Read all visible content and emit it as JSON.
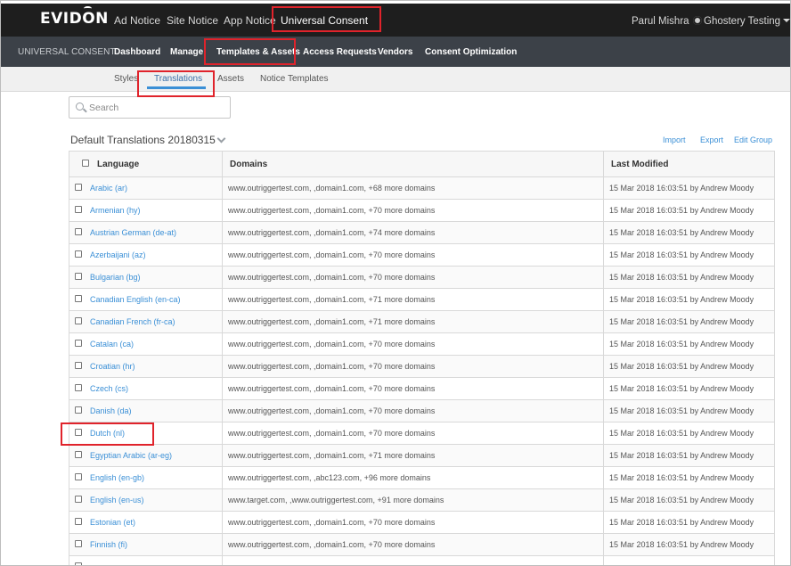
{
  "top_nav": {
    "logo": "EVIDON",
    "links": [
      "Ad Notice",
      "Site Notice",
      "App Notice",
      "Universal Consent"
    ],
    "user": "Parul Mishra",
    "account": "Ghostery Testing"
  },
  "sub_nav": {
    "title": "UNIVERSAL CONSENT",
    "items": [
      "Dashboard",
      "Manage",
      "Templates & Assets",
      "Access Requests",
      "Vendors",
      "Consent Optimization"
    ]
  },
  "third_nav": {
    "items": [
      "Styles",
      "Translations",
      "Assets",
      "Notice Templates"
    ],
    "active": "Translations"
  },
  "search": {
    "placeholder": "Search"
  },
  "group": {
    "title": "Default Translations 20180315",
    "actions": [
      "Import",
      "Export",
      "Edit Group"
    ]
  },
  "table": {
    "columns": [
      "Language",
      "Domains",
      "Last Modified"
    ],
    "rows": [
      {
        "language": "Arabic (ar)",
        "domains": "www.outriggertest.com, ,domain1.com, +68 more domains",
        "modified": "15 Mar 2018 16:03:51 by Andrew Moody"
      },
      {
        "language": "Armenian (hy)",
        "domains": "www.outriggertest.com, ,domain1.com, +70 more domains",
        "modified": "15 Mar 2018 16:03:51 by Andrew Moody"
      },
      {
        "language": "Austrian German (de-at)",
        "domains": "www.outriggertest.com, ,domain1.com, +74 more domains",
        "modified": "15 Mar 2018 16:03:51 by Andrew Moody"
      },
      {
        "language": "Azerbaijani (az)",
        "domains": "www.outriggertest.com, ,domain1.com, +70 more domains",
        "modified": "15 Mar 2018 16:03:51 by Andrew Moody"
      },
      {
        "language": "Bulgarian (bg)",
        "domains": "www.outriggertest.com, ,domain1.com, +70 more domains",
        "modified": "15 Mar 2018 16:03:51 by Andrew Moody"
      },
      {
        "language": "Canadian English (en-ca)",
        "domains": "www.outriggertest.com, ,domain1.com, +71 more domains",
        "modified": "15 Mar 2018 16:03:51 by Andrew Moody"
      },
      {
        "language": "Canadian French (fr-ca)",
        "domains": "www.outriggertest.com, ,domain1.com, +71 more domains",
        "modified": "15 Mar 2018 16:03:51 by Andrew Moody"
      },
      {
        "language": "Catalan (ca)",
        "domains": "www.outriggertest.com, ,domain1.com, +70 more domains",
        "modified": "15 Mar 2018 16:03:51 by Andrew Moody"
      },
      {
        "language": "Croatian (hr)",
        "domains": "www.outriggertest.com, ,domain1.com, +70 more domains",
        "modified": "15 Mar 2018 16:03:51 by Andrew Moody"
      },
      {
        "language": "Czech (cs)",
        "domains": "www.outriggertest.com, ,domain1.com, +70 more domains",
        "modified": "15 Mar 2018 16:03:51 by Andrew Moody"
      },
      {
        "language": "Danish (da)",
        "domains": "www.outriggertest.com, ,domain1.com, +70 more domains",
        "modified": "15 Mar 2018 16:03:51 by Andrew Moody"
      },
      {
        "language": "Dutch (nl)",
        "domains": "www.outriggertest.com, ,domain1.com, +70 more domains",
        "modified": "15 Mar 2018 16:03:51 by Andrew Moody"
      },
      {
        "language": "Egyptian Arabic (ar-eg)",
        "domains": "www.outriggertest.com, ,domain1.com, +71 more domains",
        "modified": "15 Mar 2018 16:03:51 by Andrew Moody"
      },
      {
        "language": "English (en-gb)",
        "domains": "www.outriggertest.com, ,abc123.com, +96 more domains",
        "modified": "15 Mar 2018 16:03:51 by Andrew Moody"
      },
      {
        "language": "English (en-us)",
        "domains": "www.target.com, ,www.outriggertest.com, +91 more domains",
        "modified": "15 Mar 2018 16:03:51 by Andrew Moody"
      },
      {
        "language": "Estonian (et)",
        "domains": "www.outriggertest.com, ,domain1.com, +70 more domains",
        "modified": "15 Mar 2018 16:03:51 by Andrew Moody"
      },
      {
        "language": "Finnish (fi)",
        "domains": "www.outriggertest.com, ,domain1.com, +70 more domains",
        "modified": "15 Mar 2018 16:03:51 by Andrew Moody"
      },
      {
        "language": "",
        "domains": "",
        "modified": ""
      }
    ]
  },
  "colors": {
    "top_bar": "#1e1e1e",
    "sub_bar": "#3c4148",
    "link": "#3a8fd6",
    "highlight": "#e0232b"
  }
}
